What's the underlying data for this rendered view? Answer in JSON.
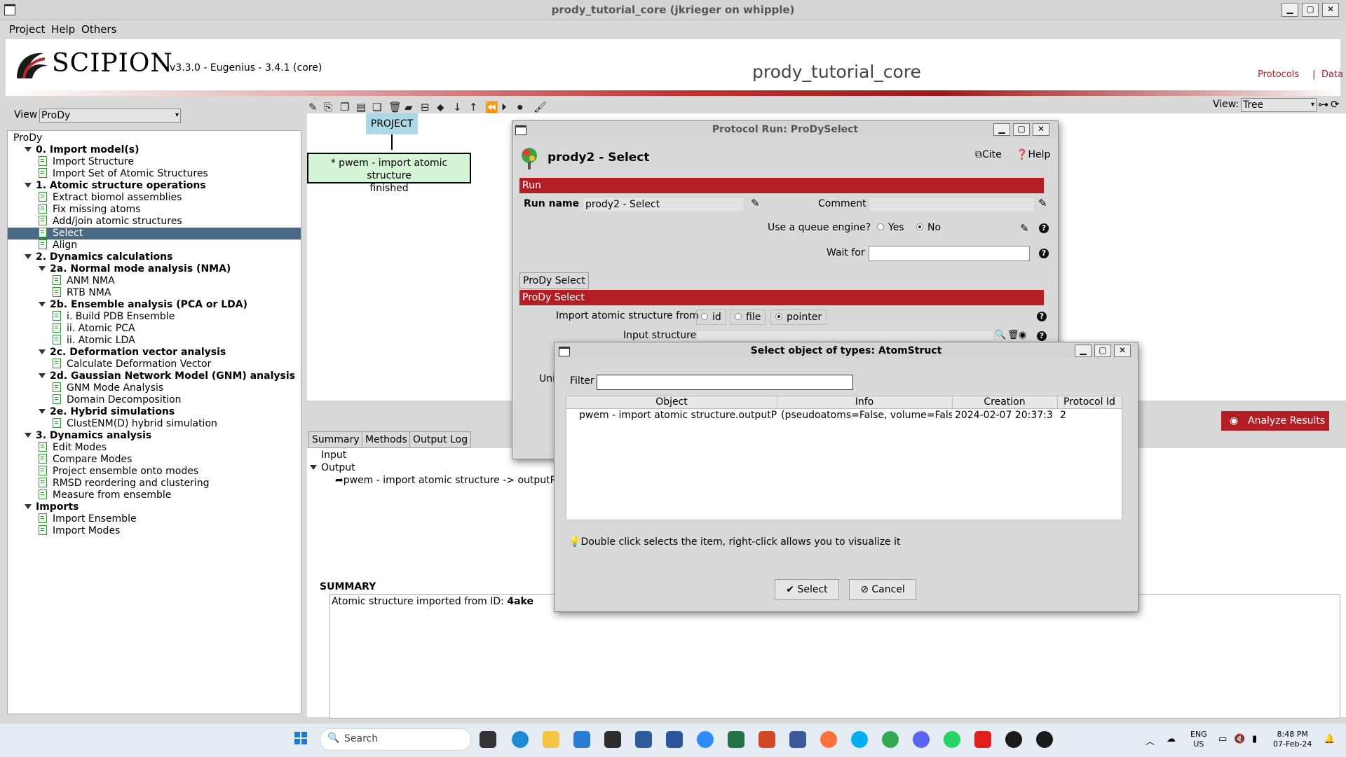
{
  "window": {
    "title": "prody_tutorial_core (jkrieger on whipple)"
  },
  "menu": [
    "Project",
    "Help",
    "Others"
  ],
  "header": {
    "logo_text": "SCIPION",
    "version": "v3.3.0 - Eugenius - 3.4.1 (core)",
    "project_name": "prody_tutorial_core",
    "link_protocols": "Protocols",
    "link_sep": "|",
    "link_data": "Data"
  },
  "left": {
    "view_label": "View",
    "view_value": "ProDy",
    "tree": [
      {
        "text": "ProDy",
        "level": 0,
        "type": "root"
      },
      {
        "text": "0. Import model(s)",
        "level": 1,
        "type": "group"
      },
      {
        "text": "Import Structure",
        "level": 2,
        "type": "item"
      },
      {
        "text": "Import Set of Atomic Structures",
        "level": 2,
        "type": "item"
      },
      {
        "text": "1. Atomic structure operations",
        "level": 1,
        "type": "group"
      },
      {
        "text": "Extract biomol assemblies",
        "level": 2,
        "type": "item"
      },
      {
        "text": "Fix missing atoms",
        "level": 2,
        "type": "item"
      },
      {
        "text": "Add/join atomic structures",
        "level": 2,
        "type": "item"
      },
      {
        "text": "Select",
        "level": 2,
        "type": "item",
        "selected": true
      },
      {
        "text": "Align",
        "level": 2,
        "type": "item"
      },
      {
        "text": "2. Dynamics calculations",
        "level": 1,
        "type": "group"
      },
      {
        "text": "2a. Normal mode analysis (NMA)",
        "level": 2,
        "type": "group"
      },
      {
        "text": "ANM NMA",
        "level": 3,
        "type": "item"
      },
      {
        "text": "RTB NMA",
        "level": 3,
        "type": "item"
      },
      {
        "text": "2b. Ensemble analysis (PCA or LDA)",
        "level": 2,
        "type": "group"
      },
      {
        "text": "i. Build PDB Ensemble",
        "level": 3,
        "type": "item"
      },
      {
        "text": "ii. Atomic PCA",
        "level": 3,
        "type": "item"
      },
      {
        "text": "ii. Atomic LDA",
        "level": 3,
        "type": "item"
      },
      {
        "text": "2c. Deformation vector analysis",
        "level": 2,
        "type": "group"
      },
      {
        "text": "Calculate Deformation Vector",
        "level": 3,
        "type": "item"
      },
      {
        "text": "2d. Gaussian Network Model (GNM) analysis",
        "level": 2,
        "type": "group"
      },
      {
        "text": "GNM Mode Analysis",
        "level": 3,
        "type": "item"
      },
      {
        "text": "Domain Decomposition",
        "level": 3,
        "type": "item"
      },
      {
        "text": "2e. Hybrid simulations",
        "level": 2,
        "type": "group"
      },
      {
        "text": "ClustENM(D) hybrid simulation",
        "level": 3,
        "type": "item"
      },
      {
        "text": "3. Dynamics analysis",
        "level": 1,
        "type": "group"
      },
      {
        "text": "Edit Modes",
        "level": 2,
        "type": "item"
      },
      {
        "text": "Compare Modes",
        "level": 2,
        "type": "item"
      },
      {
        "text": "Project ensemble onto modes",
        "level": 2,
        "type": "item"
      },
      {
        "text": "RMSD reordering and clustering",
        "level": 2,
        "type": "item"
      },
      {
        "text": "Measure from ensemble",
        "level": 2,
        "type": "item"
      },
      {
        "text": "Imports",
        "level": 1,
        "type": "group"
      },
      {
        "text": "Import Ensemble",
        "level": 2,
        "type": "item"
      },
      {
        "text": "Import Modes",
        "level": 2,
        "type": "item"
      }
    ]
  },
  "graph": {
    "view_label": "View:",
    "view_value": "Tree",
    "project_node": "PROJECT",
    "run_node_line1": "* pwem - import atomic structure",
    "run_node_line2": "finished"
  },
  "bottom": {
    "tabs": [
      "Summary",
      "Methods",
      "Output Log"
    ],
    "input_label": "Input",
    "output_label": "Output",
    "output_item": "pwem - import atomic structure -> outputPdb",
    "analyze_button": "Analyze Results",
    "summary_title": "SUMMARY",
    "summary_text": "Atomic structure imported from ID: ",
    "summary_id": "4ake"
  },
  "protocol_dialog": {
    "title": "Protocol Run: ProDySelect",
    "heading": "prody2 - Select",
    "cite": "Cite",
    "help": "Help",
    "run_section": "Run",
    "run_name_label": "Run name",
    "run_name_value": "prody2 - Select",
    "comment_label": "Comment",
    "queue_label": "Use a queue engine?",
    "queue_yes": "Yes",
    "queue_no": "No",
    "wait_label": "Wait for",
    "tab_label": "ProDy Select",
    "section_label": "ProDy Select",
    "import_from_label": "Import atomic structure from",
    "opt_id": "id",
    "opt_file": "file",
    "opt_pointer": "pointer",
    "input_structure_label": "Input structure",
    "cut_label": "Uni"
  },
  "select_dialog": {
    "title": "Select object of types: AtomStruct",
    "filter_label": "Filter",
    "columns": [
      "Object",
      "Info",
      "Creation",
      "Protocol Id"
    ],
    "rows": [
      {
        "object": "pwem - import atomic structure.outputPdb",
        "info": "(pseudoatoms=False, volume=False",
        "creation": "2024-02-07 20:37:3",
        "protocol_id": "2"
      }
    ],
    "hint": "Double click selects the item, right-click allows you to visualize it",
    "select_button": "Select",
    "cancel_button": "Cancel"
  },
  "taskbar": {
    "search_placeholder": "Search",
    "lang_line1": "ENG",
    "lang_line2": "US",
    "time": "8:48 PM",
    "date": "07-Feb-24"
  }
}
